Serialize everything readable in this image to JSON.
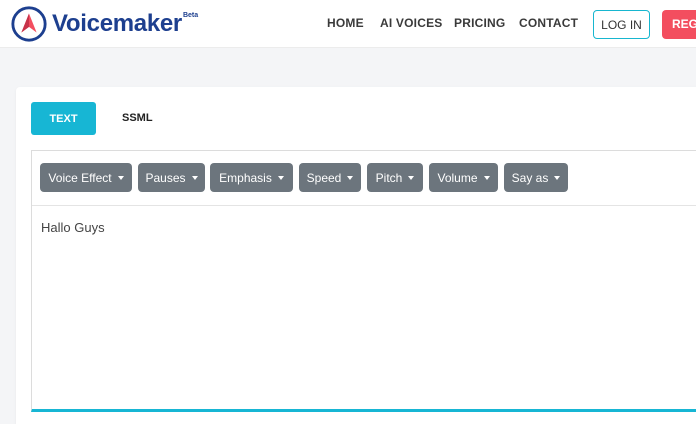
{
  "header": {
    "brand": "Voicemaker",
    "beta": "Beta",
    "nav": [
      "HOME",
      "AI VOICES",
      "PRICING",
      "CONTACT"
    ],
    "login": "LOG IN",
    "register": "REGI"
  },
  "tabs": {
    "text": "TEXT",
    "ssml": "SSML"
  },
  "toolbar": [
    "Voice Effect",
    "Pauses",
    "Emphasis",
    "Speed",
    "Pitch",
    "Volume",
    "Say as"
  ],
  "editor": {
    "content": "Hallo Guys"
  },
  "colors": {
    "accent": "#17b6d4",
    "brand": "#1d3f8f",
    "register": "#f34e5f",
    "toolbar_button": "#6c757d"
  }
}
